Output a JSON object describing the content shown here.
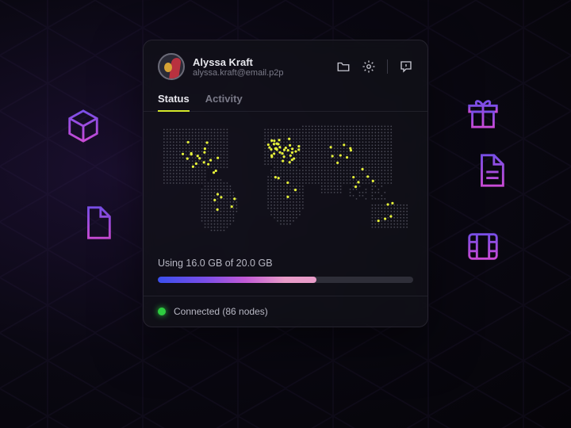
{
  "user": {
    "name": "Alyssa Kraft",
    "email": "alyssa.kraft@email.p2p"
  },
  "tabs": {
    "status": "Status",
    "activity": "Activity"
  },
  "storage": {
    "text": "Using 16.0 GB of 20.0 GB",
    "used": 16.0,
    "total": 20.0,
    "unit": "GB"
  },
  "connection": {
    "text": "Connected (86 nodes)",
    "status": "Connected",
    "nodes": 86
  },
  "colors": {
    "accent": "#d4e82a",
    "status_ok": "#2ecc40",
    "gradient_icon_from": "#5a3fd8",
    "gradient_icon_to": "#c94bd6"
  },
  "decor_icons": [
    "cube",
    "file",
    "gift",
    "document",
    "film"
  ]
}
